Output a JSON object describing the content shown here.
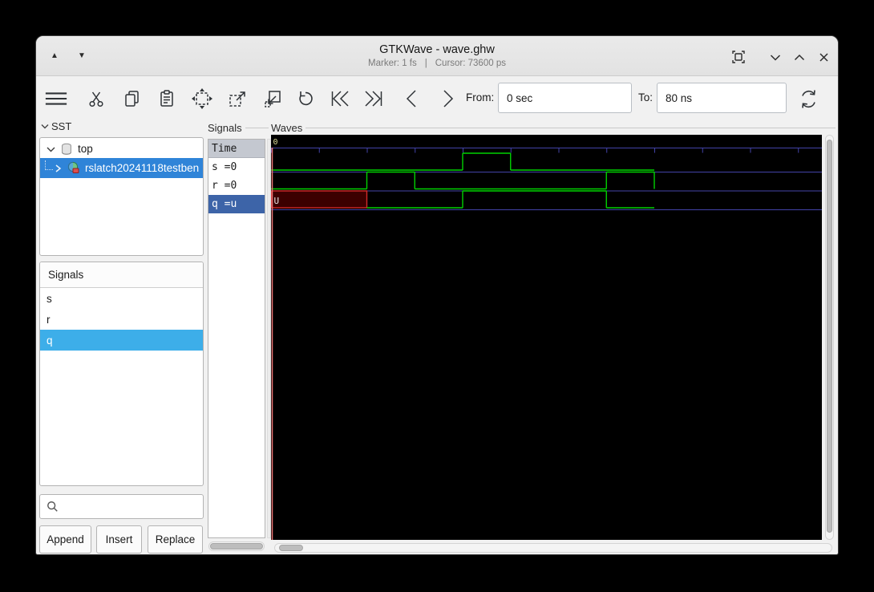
{
  "window": {
    "title": "GTKWave - wave.ghw",
    "marker_status": "Marker: 1 fs",
    "status_separator": "|",
    "cursor_status": "Cursor: 73600 ps"
  },
  "toolbar": {
    "from_label": "From:",
    "from_value": "0 sec",
    "to_label": "To:",
    "to_value": "80 ns"
  },
  "sst_panel": {
    "header": "SST",
    "tree": [
      {
        "label": "top"
      },
      {
        "label": "rslatch20241118testben"
      }
    ]
  },
  "facility_panel": {
    "header": "Signals",
    "items": [
      "s",
      "r",
      "q"
    ],
    "selected": "q"
  },
  "search": {
    "value": ""
  },
  "filter_buttons": {
    "append": "Append",
    "insert": "Insert",
    "replace": "Replace"
  },
  "signals_panel": {
    "frame_label": "Signals",
    "time_header": "Time",
    "rows": [
      {
        "text": "s =0"
      },
      {
        "text": "r =0"
      },
      {
        "text": "q =u",
        "selected": true
      }
    ]
  },
  "waves_panel": {
    "frame_label": "Waves",
    "origin_label": "0"
  },
  "wave_data": {
    "type": "digital-waveform",
    "time_unit": "ns",
    "t_start": 0,
    "t_end": 80,
    "tick_interval_ns": 10,
    "signals": [
      {
        "name": "s",
        "segments": [
          [
            0,
            40,
            "0"
          ],
          [
            40,
            50,
            "1"
          ],
          [
            50,
            80,
            "0"
          ]
        ]
      },
      {
        "name": "r",
        "segments": [
          [
            0,
            20,
            "0"
          ],
          [
            20,
            30,
            "1"
          ],
          [
            30,
            70,
            "0"
          ],
          [
            70,
            80,
            "1"
          ]
        ]
      },
      {
        "name": "q",
        "segments": [
          [
            0,
            20,
            "U"
          ],
          [
            20,
            40,
            "0"
          ],
          [
            40,
            70,
            "1"
          ],
          [
            70,
            80,
            "0"
          ]
        ]
      }
    ],
    "colors": {
      "background": "#000000",
      "trace": "#00d200",
      "grid": "#4343a8",
      "undefined_fill": "#3c0000",
      "undefined_stroke": "#d42a2a",
      "marker": "#e87272",
      "time_text": "#dada96"
    }
  }
}
